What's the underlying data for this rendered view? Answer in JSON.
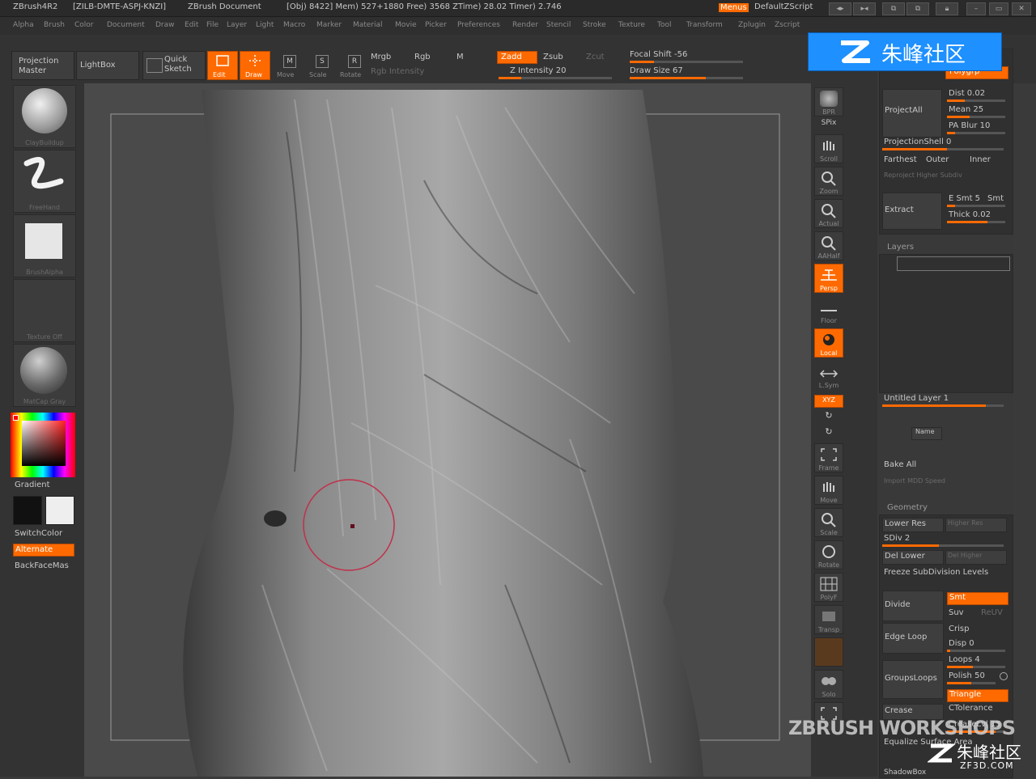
{
  "titlebar": {
    "app": "ZBrush4R2",
    "serial": "[ZILB-DMTE-ASPJ-KNZI]",
    "document": "ZBrush Document",
    "stats": "[Obj) 8422] Mem) 527+1880 Free) 3568 ZTime) 28.02 Timer) 2.746",
    "menus_label": "Menus",
    "script_label": "DefaultZScript"
  },
  "menubar": [
    "Alpha",
    "Brush",
    "Color",
    "Document",
    "Draw",
    "Edit",
    "File",
    "Layer",
    "Light",
    "Macro",
    "Marker",
    "Material",
    "Movie",
    "Picker",
    "Preferences",
    "Render",
    "Stencil",
    "Stroke",
    "Texture",
    "Tool",
    "Transform",
    "Zplugin",
    "Zscript"
  ],
  "toolbar": {
    "projection_master": "Projection Master",
    "lightbox": "LightBox",
    "quick_sketch": "Quick Sketch",
    "edit": "Edit",
    "draw": "Draw",
    "move": "Move",
    "scale": "Scale",
    "rotate": "Rotate",
    "mrgb": "Mrgb",
    "rgb": "Rgb",
    "m": "M",
    "zadd": "Zadd",
    "zsub": "Zsub",
    "zcut": "Zcut",
    "rgb_intensity": "Rgb Intensity",
    "z_intensity": "Z Intensity 20",
    "focal_shift": "Focal Shift -56",
    "draw_size": "Draw Size 67",
    "z_intensity_pct": 0.2,
    "draw_size_pct": 0.67
  },
  "left_shelf": {
    "brush": "ClayBuildup",
    "stroke": "FreeHand",
    "alpha": "BrushAlpha",
    "texture": "Texture Off",
    "material": "MatCap Gray",
    "gradient": "Gradient",
    "switchcolor": "SwitchColor",
    "alternate": "Alternate",
    "backface": "BackFaceMas"
  },
  "right_shelf": [
    "BPR",
    "SPix",
    "Scroll",
    "Zoom",
    "Actual",
    "AAHalf",
    "Persp",
    "Floor",
    "Local",
    "L.Sym",
    "XYZ",
    "",
    "",
    "Frame",
    "Move",
    "Scale",
    "Rotate",
    "PolyF",
    "Transp",
    "",
    "Solo",
    ""
  ],
  "right_panel": {
    "polygrp": "Polygrp",
    "dist": "Dist 0.02",
    "mean": "Mean 25",
    "pa_blur": "PA Blur 10",
    "project_all": "ProjectAll",
    "projection_shell": "ProjectionShell 0",
    "farthest": "Farthest",
    "outer": "Outer",
    "inner": "Inner",
    "reproject_higher": "Reproject Higher Subdiv",
    "extract": "Extract",
    "esmt": "E Smt 5",
    "smt": "Smt",
    "thick": "Thick 0.02",
    "layers_title": "Layers",
    "untitled_layer": "Untitled Layer 1",
    "name": "Name",
    "bake_all": "Bake All",
    "import_mdd": "Import MDD Speed",
    "geometry_title": "Geometry",
    "lower_res": "Lower Res",
    "higher_res": "Higher Res",
    "sdiv": "SDiv 2",
    "del_lower": "Del Lower",
    "del_higher": "Del Higher",
    "freeze": "Freeze SubDivision Levels",
    "divide": "Divide",
    "smt_btn": "Smt",
    "suv": "Suv",
    "reuv": "ReUV",
    "edge_loop": "Edge Loop",
    "crisp": "Crisp",
    "disp": "Disp 0",
    "loops": "Loops 4",
    "grouploops": "GroupsLoops",
    "polish": "Polish 50",
    "triangle": "Triangle",
    "crease": "Crease",
    "ctolerance": "CTolerance",
    "creaselvl": "CreaseLvl 15",
    "equalize": "Equalize Surface Area",
    "shadowbox": "ShadowBox"
  },
  "watermarks": {
    "top": "朱峰社区",
    "workshops": "ZBRUSH WORKSHOPS",
    "bottom": "朱峰社区",
    "bottom_url": "ZF3D.COM"
  },
  "colors": {
    "accent": "#ff6a00",
    "panel": "#333333",
    "canvas": "#4a4a4a",
    "watermark_blue": "#1e90ff"
  }
}
